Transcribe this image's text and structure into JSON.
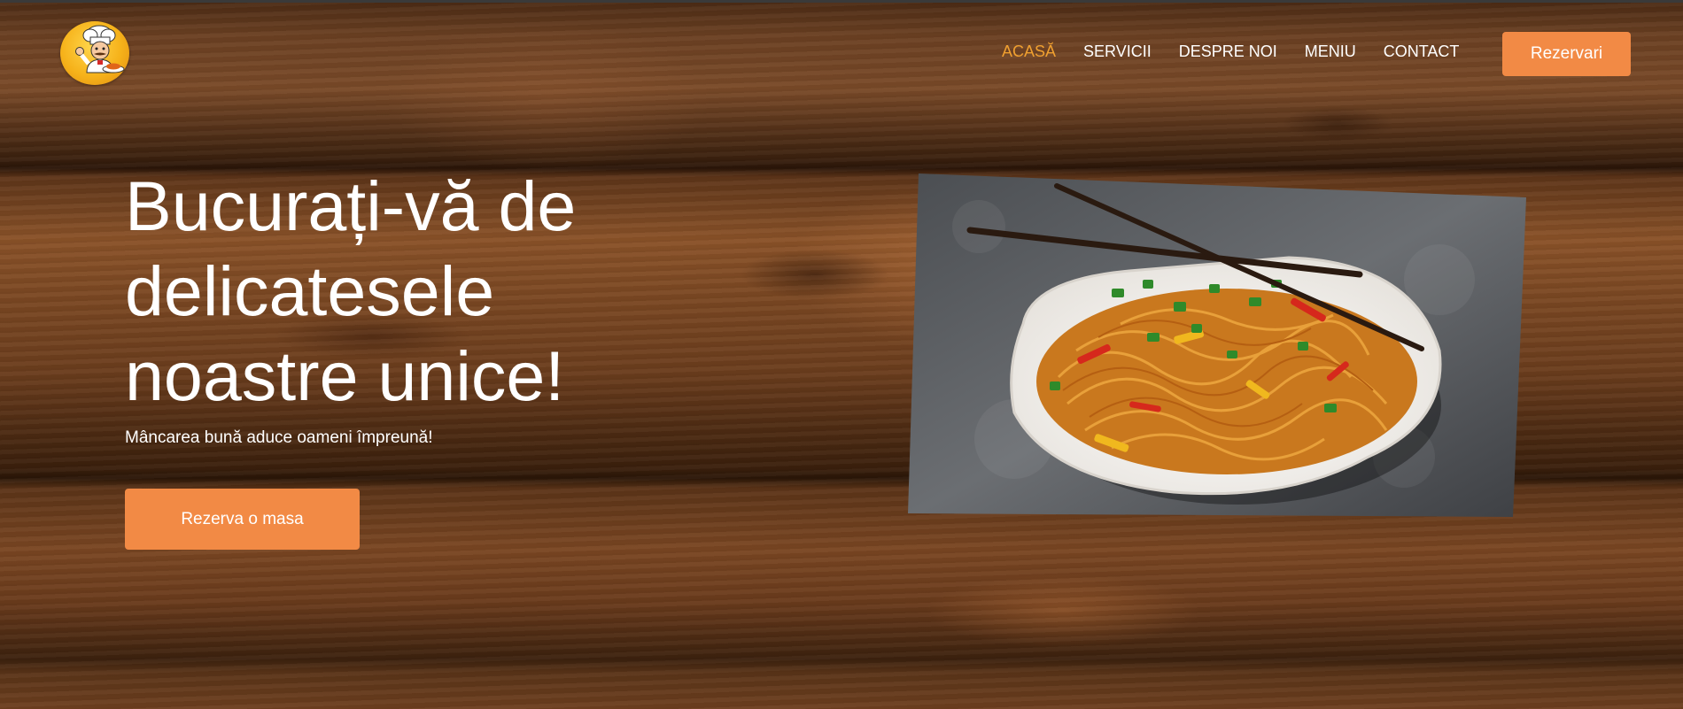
{
  "header": {
    "nav": [
      {
        "label": "ACASĂ",
        "active": true
      },
      {
        "label": "SERVICII",
        "active": false
      },
      {
        "label": "DESPRE NOI",
        "active": false
      },
      {
        "label": "MENIU",
        "active": false
      },
      {
        "label": "CONTACT",
        "active": false
      }
    ],
    "cta_label": "Rezervari",
    "logo_icon": "chef-mascot-icon"
  },
  "hero": {
    "title": "Bucurați-vă de delicatesele noastre unice!",
    "subtitle": "Mâncarea bună aduce oameni împreună!",
    "cta_label": "Rezerva o masa",
    "image": "noodles-dish-photo"
  },
  "colors": {
    "accent": "#f28a45",
    "nav_active": "#f0a030",
    "text": "#ffffff"
  }
}
